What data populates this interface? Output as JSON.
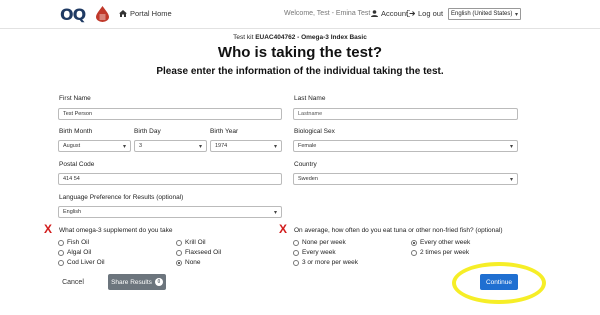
{
  "header": {
    "portal_home": "Portal Home",
    "welcome": "Welcome, Test - Emina Test",
    "account": "Account",
    "logout": "Log out",
    "language_selected": "English (United States)",
    "logo_text": "OQ"
  },
  "page": {
    "kit_prefix": "Test kit",
    "kit_id": "EUAC404762 - Omega-3 Index Basic",
    "title": "Who is taking the test?",
    "subtitle": "Please enter the information of the individual taking the test."
  },
  "form": {
    "first_name_label": "First Name",
    "first_name_value": "Test Person",
    "last_name_label": "Last Name",
    "last_name_placeholder": "Lastname",
    "birth_month_label": "Birth Month",
    "birth_month_value": "August",
    "birth_day_label": "Birth Day",
    "birth_day_value": "3",
    "birth_year_label": "Birth Year",
    "birth_year_value": "1974",
    "bio_sex_label": "Biological Sex",
    "bio_sex_value": "Female",
    "postal_label": "Postal Code",
    "postal_value": "414 54",
    "country_label": "Country",
    "country_value": "Sweden",
    "lang_pref_label": "Language Preference for Results (optional)",
    "lang_pref_value": "English"
  },
  "supplement": {
    "question": "What omega-3 supplement do you take",
    "col1": [
      "Fish Oil",
      "Algal Oil",
      "Cod Liver Oil"
    ],
    "col2": [
      "Krill Oil",
      "Flaxseed Oil",
      "None"
    ],
    "selected": "None"
  },
  "fish": {
    "question": "On average, how often do you eat tuna or other non-fried fish? (optional)",
    "col1": [
      "None per week",
      "Every week",
      "3 or more per week"
    ],
    "col2": [
      "Every other week",
      "2 times per week"
    ],
    "selected": "Every other week"
  },
  "buttons": {
    "cancel": "Cancel",
    "share": "Share Results",
    "share_count": "0",
    "continue": "Continue"
  },
  "marks": {
    "x": "X",
    "x_color": "#d21c1c",
    "highlight_color": "#f6ee27",
    "brand_blue": "#1f6fd1"
  }
}
